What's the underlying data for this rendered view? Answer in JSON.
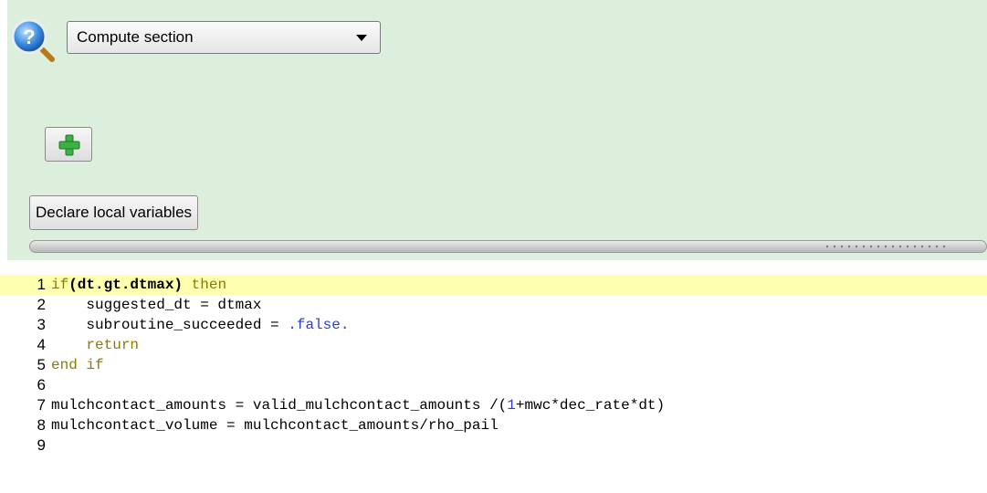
{
  "toolbar": {
    "section_select": {
      "selected": "Compute section"
    },
    "declare_label": "Declare local variables"
  },
  "icons": {
    "help": "help-magnifier-icon",
    "add": "plus-icon",
    "dropdown": "chevron-down-icon"
  },
  "colors": {
    "panel_bg": "#dcefdc",
    "current_line_bg": "#ffffb0",
    "keyword": "#8b7b00",
    "literal": "#2a3ce0",
    "plus_green": "#3cb043"
  },
  "editor": {
    "lines": [
      {
        "number": "1",
        "segments": [
          {
            "t": "if",
            "c": "kw"
          },
          {
            "t": "(dt.gt.dtmax)",
            "c": "bold"
          },
          {
            "t": " then",
            "c": "kw"
          }
        ],
        "current": true
      },
      {
        "number": "2",
        "segments": [
          {
            "t": "    suggested_dt = dtmax",
            "c": ""
          }
        ]
      },
      {
        "number": "3",
        "segments": [
          {
            "t": "    subroutine_succeeded = ",
            "c": ""
          },
          {
            "t": ".false.",
            "c": "lit"
          }
        ]
      },
      {
        "number": "4",
        "segments": [
          {
            "t": "    return",
            "c": "kw"
          }
        ]
      },
      {
        "number": "5",
        "segments": [
          {
            "t": "end if",
            "c": "kw"
          }
        ]
      },
      {
        "number": "6",
        "segments": []
      },
      {
        "number": "7",
        "segments": [
          {
            "t": "mulchcontact_amounts = valid_mulchcontact_amounts /(",
            "c": ""
          },
          {
            "t": "1",
            "c": "lit"
          },
          {
            "t": "+mwc*dec_rate*dt)",
            "c": ""
          }
        ]
      },
      {
        "number": "8",
        "segments": [
          {
            "t": "mulchcontact_volume = mulchcontact_amounts/rho_pail",
            "c": ""
          }
        ]
      },
      {
        "number": "9",
        "segments": []
      }
    ]
  }
}
